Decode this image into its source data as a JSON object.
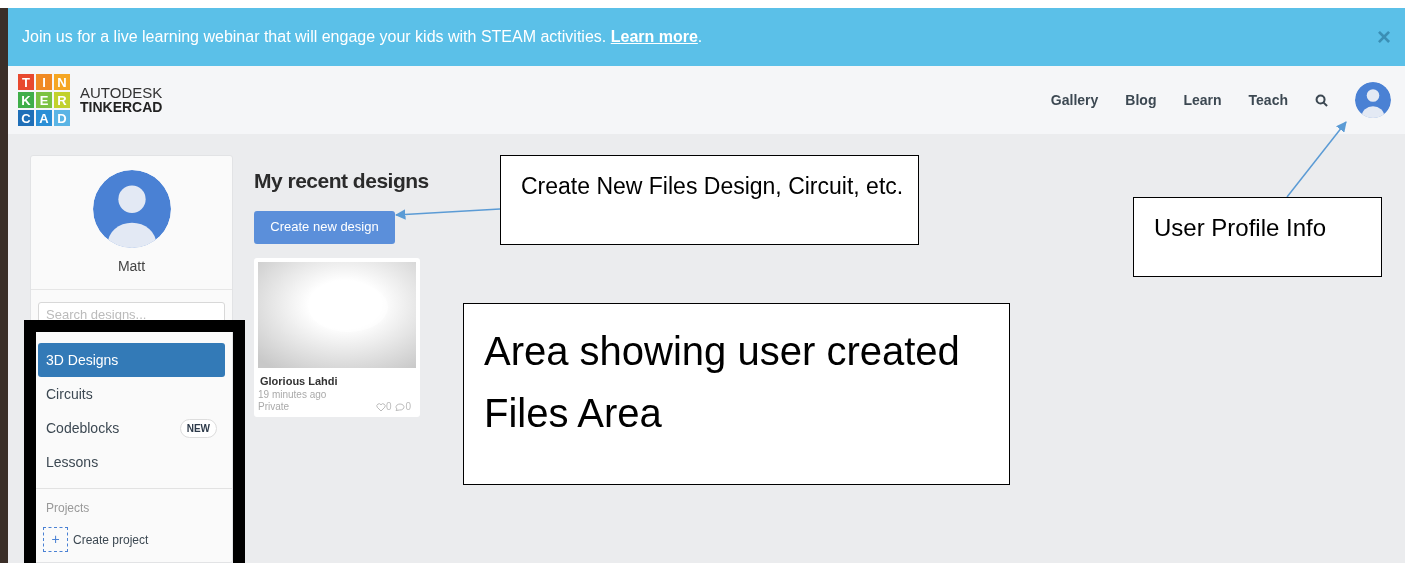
{
  "banner": {
    "text": "Join us for a live learning webinar that will engage your kids with STEAM activities. ",
    "link": "Learn more",
    "tail": ".",
    "close": "×"
  },
  "logo": {
    "tiles": [
      {
        "letter": "T",
        "color": "#e8492f"
      },
      {
        "letter": "I",
        "color": "#f08a24"
      },
      {
        "letter": "N",
        "color": "#f5a623"
      },
      {
        "letter": "K",
        "color": "#3fae49"
      },
      {
        "letter": "E",
        "color": "#7cc242"
      },
      {
        "letter": "R",
        "color": "#c2d12c"
      },
      {
        "letter": "C",
        "color": "#1f6fb8"
      },
      {
        "letter": "A",
        "color": "#2b8fd6"
      },
      {
        "letter": "D",
        "color": "#5ab4e5"
      }
    ],
    "brand_top": "AUTODESK",
    "brand_bottom": "TINKERCAD"
  },
  "nav": [
    "Gallery",
    "Blog",
    "Learn",
    "Teach"
  ],
  "sidebar": {
    "user_name": "Matt",
    "search": {
      "placeholder": "Search designs..."
    },
    "items": [
      {
        "label": "3D Designs",
        "selected": true
      },
      {
        "label": "Circuits",
        "selected": false
      },
      {
        "label": "Codeblocks",
        "selected": false,
        "badge": "NEW"
      },
      {
        "label": "Lessons",
        "selected": false
      }
    ],
    "projects_heading": "Projects",
    "create_project": {
      "icon": "+",
      "label": "Create project"
    }
  },
  "main": {
    "heading": "My recent designs",
    "create_button": "Create new design",
    "designs": [
      {
        "title": "Glorious Lahdi",
        "time": "19 minutes ago",
        "visibility": "Private",
        "likes": "0",
        "comments": "0"
      }
    ]
  },
  "annotations": [
    {
      "text": "Create New Files Design, Circuit, etc."
    },
    {
      "text": "User Profile Info"
    },
    {
      "text": "Area showing user created Files Area"
    }
  ]
}
